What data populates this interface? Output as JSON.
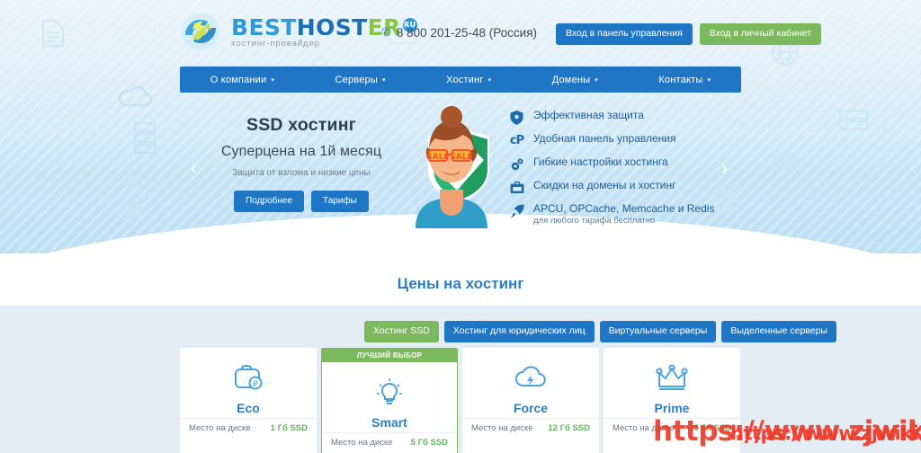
{
  "header": {
    "logo": {
      "word_part1": "BEST",
      "word_part2": "HOST",
      "word_part3": "ER",
      "tld_badge": "RU",
      "tagline": "хостинг-провайдер"
    },
    "phone": "8 800 201-25-48 (Россия)",
    "buttons": [
      {
        "label": "Вход в панель управления",
        "style": "blue"
      },
      {
        "label": "Вход в личный кабинет",
        "style": "green"
      }
    ]
  },
  "nav": {
    "items": [
      {
        "label": "О компании"
      },
      {
        "label": "Серверы"
      },
      {
        "label": "Хостинг"
      },
      {
        "label": "Домены"
      },
      {
        "label": "Контакты"
      }
    ],
    "caret": "▾"
  },
  "hero": {
    "prev_arrow": "‹",
    "next_arrow": "›",
    "title": "SSD хостинг",
    "subtitle": "Суперцена на 1й месяц",
    "note": "Защита от взлома и низкие цены",
    "buttons": [
      {
        "label": "Подробнее"
      },
      {
        "label": "Тарифы"
      }
    ],
    "art_text": "SALE",
    "features": [
      {
        "icon": "shield-icon",
        "text": "Эффективная защита",
        "sub": ""
      },
      {
        "icon": "cpanel-icon",
        "text": "Удобная панель управления",
        "sub": ""
      },
      {
        "icon": "gears-icon",
        "text": "Гибкие настройки хостинга",
        "sub": ""
      },
      {
        "icon": "briefcase-icon",
        "text": "Скидки на домены и хостинг",
        "sub": ""
      },
      {
        "icon": "rocket-icon",
        "text": "APCU, OPCache, Memcache и Redis",
        "sub": "для любого тарифа бесплатно"
      }
    ]
  },
  "pricing": {
    "title": "Цены на хостинг",
    "tabs": [
      {
        "label": "Хостинг SSD",
        "active": true
      },
      {
        "label": "Хостинг для юридических лиц",
        "active": false
      },
      {
        "label": "Виртуальные серверы",
        "active": false
      },
      {
        "label": "Выделенные серверы",
        "active": false
      }
    ],
    "best_badge": "ЛУЧШИЙ ВЫБОР",
    "row_label": "Место на диске",
    "cards": [
      {
        "name": "Eco",
        "icon": "wallet-icon",
        "disk": "1 Гб SSD",
        "best": false
      },
      {
        "name": "Smart",
        "icon": "lightbulb-icon",
        "disk": "5 Гб SSD",
        "best": true
      },
      {
        "name": "Force",
        "icon": "cloud-bolt-icon",
        "disk": "12 Гб SSD",
        "best": false
      },
      {
        "name": "Prime",
        "icon": "crown-icon",
        "disk": "25 Гб SSD",
        "best": false
      }
    ]
  },
  "watermarks": {
    "primary": "https://www.zjwiki.com",
    "secondary": "https://www.zjwiki.com"
  },
  "colors": {
    "nav_blue": "#1f76c4",
    "accent_green": "#7cb85e",
    "title_blue": "#2e7cc2",
    "watermark_red": "#ef3b2c"
  }
}
